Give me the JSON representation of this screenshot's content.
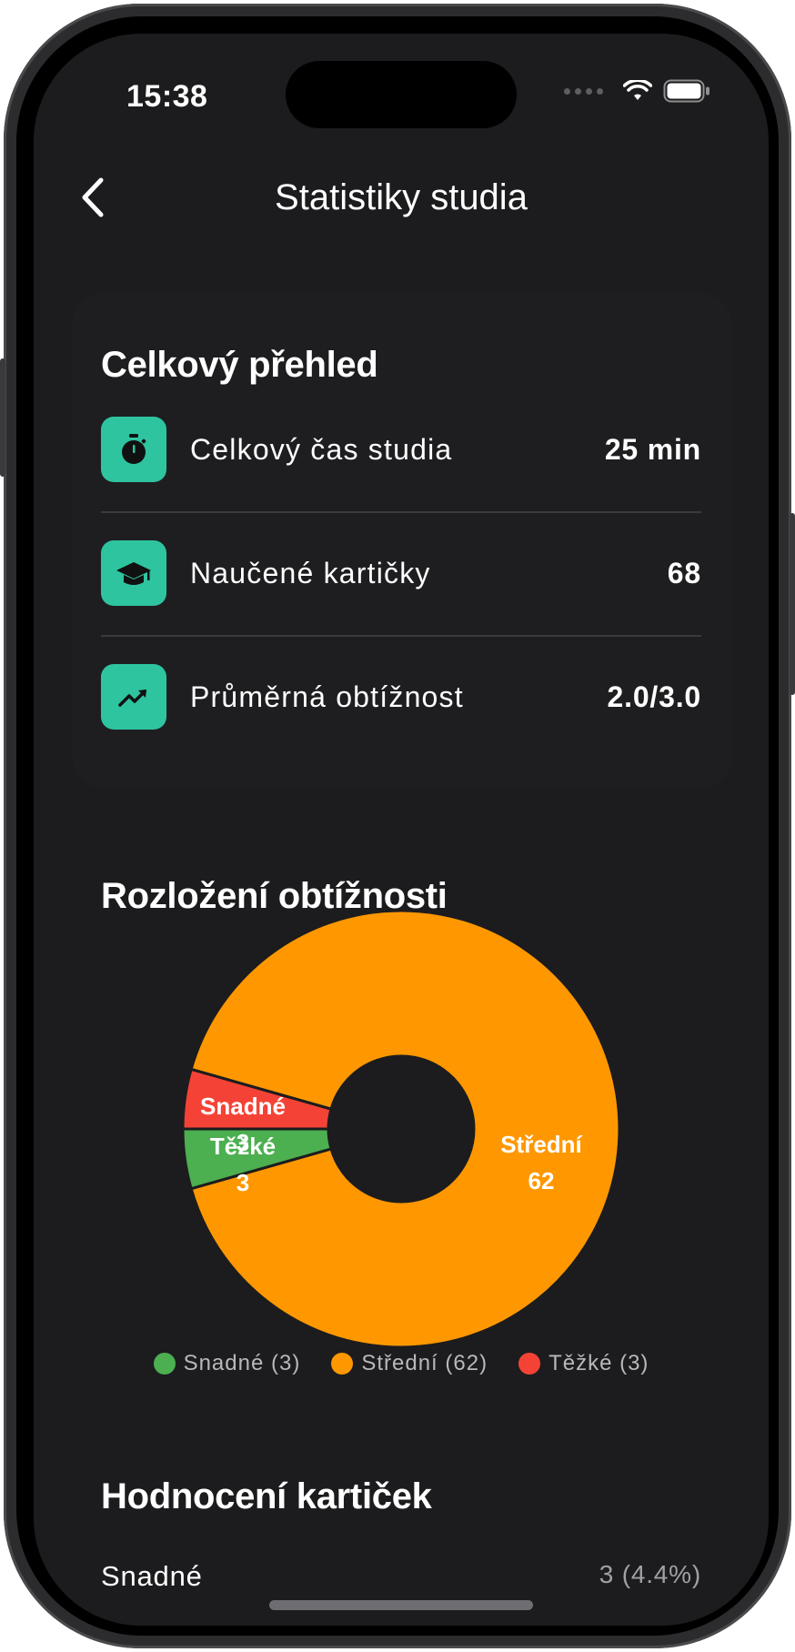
{
  "status_bar": {
    "time": "15:38"
  },
  "nav": {
    "title": "Statistiky studia"
  },
  "overview": {
    "title": "Celkový přehled",
    "rows": [
      {
        "icon": "stopwatch-icon",
        "label": "Celkový čas studia",
        "value": "25 min"
      },
      {
        "icon": "graduation-cap-icon",
        "label": "Naučené kartičky",
        "value": "68"
      },
      {
        "icon": "trending-up-icon",
        "label": "Průměrná obtížnost",
        "value": "2.0/3.0"
      }
    ]
  },
  "difficulty": {
    "title": "Rozložení obtížnosti",
    "legend": [
      "Snadné (3)",
      "Střední (62)",
      "Těžké (3)"
    ]
  },
  "chart_data": {
    "type": "pie",
    "categories": [
      "Snadné",
      "Střední",
      "Těžké"
    ],
    "values": [
      3,
      62,
      3
    ],
    "colors": [
      "#4caf50",
      "#ff9800",
      "#f44336"
    ],
    "labels": [
      "Snadné\n3",
      "Střední\n62",
      "Těžké\n3"
    ],
    "donut": true
  },
  "ratings": {
    "title": "Hodnocení kartiček",
    "rows": [
      {
        "label": "Snadné",
        "value": "3 (4.4%)"
      }
    ]
  },
  "colors": {
    "accent": "#2ec4a0",
    "background": "#1c1c1e"
  }
}
